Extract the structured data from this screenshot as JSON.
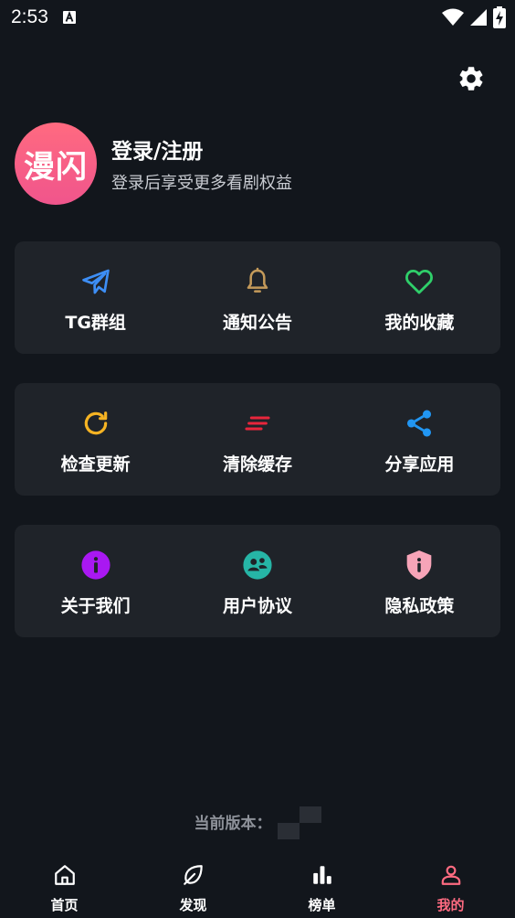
{
  "status_bar": {
    "time": "2:53",
    "notification_icon": "a-letter-icon",
    "icons": [
      "wifi-icon",
      "signal-icon",
      "battery-charging-icon"
    ]
  },
  "settings": {
    "icon": "gear-icon"
  },
  "profile": {
    "avatar_text": "漫闪",
    "title": "登录/注册",
    "subtitle": "登录后享受更多看剧权益"
  },
  "cards": [
    {
      "items": [
        {
          "label": "TG群组",
          "icon": "telegram-icon",
          "color": "#3d8ef5"
        },
        {
          "label": "通知公告",
          "icon": "bell-icon",
          "color": "#c49a5a"
        },
        {
          "label": "我的收藏",
          "icon": "heart-icon",
          "color": "#2fcf6a"
        }
      ]
    },
    {
      "items": [
        {
          "label": "检查更新",
          "icon": "refresh-icon",
          "color": "#f5b323"
        },
        {
          "label": "清除缓存",
          "icon": "clear-lines-icon",
          "color": "#e8263c"
        },
        {
          "label": "分享应用",
          "icon": "share-icon",
          "color": "#2196f3"
        }
      ]
    },
    {
      "items": [
        {
          "label": "关于我们",
          "icon": "info-icon",
          "color": "#a918f2"
        },
        {
          "label": "用户协议",
          "icon": "user-agreement-icon",
          "color": "#26b5a6"
        },
        {
          "label": "隐私政策",
          "icon": "shield-icon",
          "color": "#f7a4b8"
        }
      ]
    }
  ],
  "version": {
    "label": "当前版本："
  },
  "bottom_nav": [
    {
      "label": "首页",
      "icon": "home-icon",
      "active": false
    },
    {
      "label": "发现",
      "icon": "leaf-icon",
      "active": false
    },
    {
      "label": "榜单",
      "icon": "bar-chart-icon",
      "active": false
    },
    {
      "label": "我的",
      "icon": "user-icon",
      "active": true
    }
  ],
  "colors": {
    "background": "#12161c",
    "card": "#1f2329",
    "accent": "#ff6b81"
  }
}
